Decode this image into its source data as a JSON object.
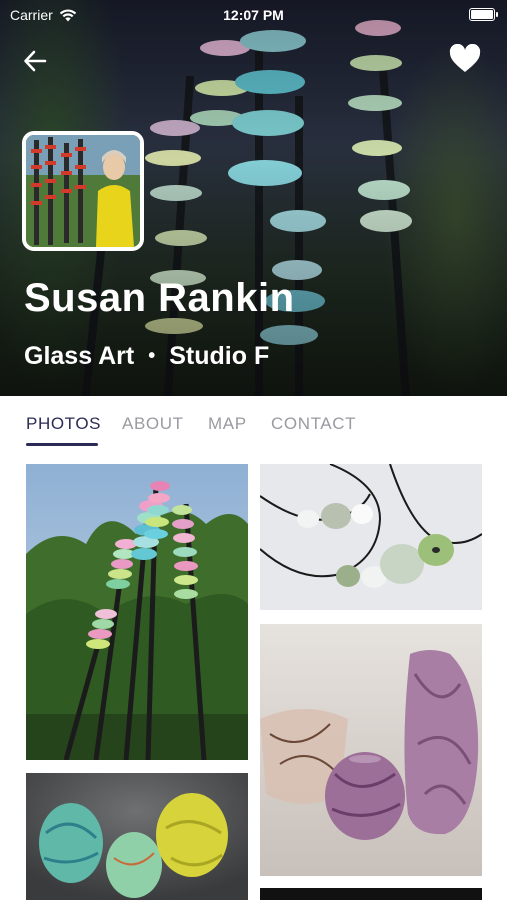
{
  "status_bar": {
    "carrier": "Carrier",
    "time": "12:07 PM"
  },
  "artist": {
    "name": "Susan Rankin",
    "medium": "Glass Art",
    "separator": "•",
    "studio": "Studio F"
  },
  "tabs": [
    {
      "label": "PHOTOS",
      "active": true
    },
    {
      "label": "ABOUT",
      "active": false
    },
    {
      "label": "MAP",
      "active": false
    },
    {
      "label": "CONTACT",
      "active": false
    }
  ],
  "photos": [
    {
      "subject": "Glass disc totem sculptures in a garden"
    },
    {
      "subject": "Glass bead pendant necklaces"
    },
    {
      "subject": "Purple glass vases and bowl"
    },
    {
      "subject": "Colorful glass egg sculptures"
    },
    {
      "subject": "Dark photo tile"
    }
  ],
  "colors": {
    "tab_active": "#2c2b55",
    "tab_inactive": "#9a9aa0"
  },
  "icons": {
    "back": "back-arrow-icon",
    "favorite": "heart-icon",
    "signal": "wifi-icon",
    "battery": "battery-icon"
  }
}
